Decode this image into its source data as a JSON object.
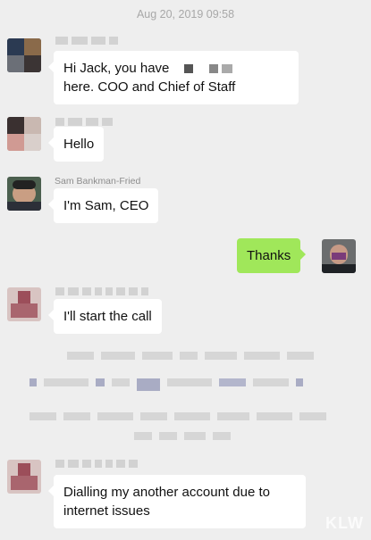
{
  "chat": {
    "timestamp": "Aug 20, 2019 09:58",
    "messages": [
      {
        "sender": "",
        "text_part1": "Hi Jack, you have",
        "text_part2": "here. COO and Chief of Staff"
      },
      {
        "sender": "",
        "text": "Hello"
      },
      {
        "sender": "Sam Bankman-Fried",
        "text": "I'm Sam, CEO"
      },
      {
        "sender": "self",
        "text": "Thanks"
      },
      {
        "sender": "",
        "text": "I'll start the call"
      },
      {
        "sender": "",
        "text": "Dialling my another account due to internet issues"
      }
    ]
  },
  "watermark": {
    "text": "KLW"
  },
  "colors": {
    "background": "#eeeeee",
    "incoming_bubble": "#ffffff",
    "outgoing_bubble": "#a0e75a"
  }
}
